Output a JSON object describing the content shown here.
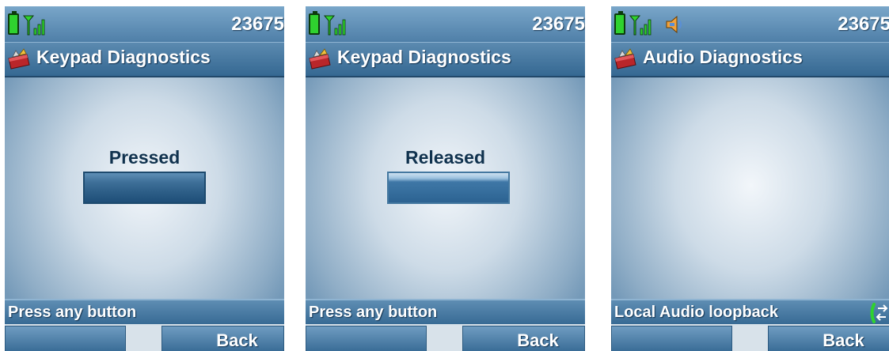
{
  "screens": [
    {
      "status": {
        "extension": "23675",
        "icons": [
          "battery-icon",
          "signal-icon"
        ]
      },
      "title": "Keypad Diagnostics",
      "title_icon": "toolbox-icon",
      "key_state": "Pressed",
      "prompt": "Press any button",
      "softkeys": {
        "left": "",
        "right": "Back"
      }
    },
    {
      "status": {
        "extension": "23675",
        "icons": [
          "battery-icon",
          "signal-icon"
        ]
      },
      "title": "Keypad Diagnostics",
      "title_icon": "toolbox-icon",
      "key_state": "Released",
      "prompt": "Press any button",
      "softkeys": {
        "left": "",
        "right": "Back"
      }
    },
    {
      "status": {
        "extension": "23675",
        "icons": [
          "battery-icon",
          "signal-icon",
          "speaker-icon"
        ]
      },
      "title": "Audio Diagnostics",
      "title_icon": "toolbox-icon",
      "prompt": "Local Audio loopback",
      "prompt_icon": "swap-icon",
      "softkeys": {
        "left": "",
        "right": "Back"
      }
    }
  ]
}
